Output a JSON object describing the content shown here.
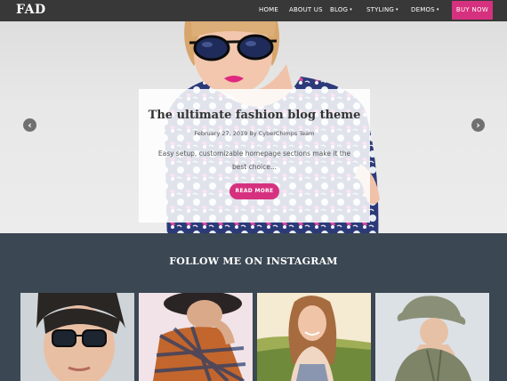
{
  "site": {
    "logo": "FAD"
  },
  "nav": {
    "items": [
      {
        "label": "HOME",
        "caret": ""
      },
      {
        "label": "ABOUT US",
        "caret": ""
      },
      {
        "label": "BLOG",
        "caret": "▾"
      },
      {
        "label": "STYLING",
        "caret": "▾"
      },
      {
        "label": "DEMOS",
        "caret": "▾"
      }
    ],
    "cta": "BUY NOW"
  },
  "hero": {
    "prev_arrow": "‹",
    "next_arrow": "›",
    "title": "The ultimate fashion blog theme",
    "meta": "February 27, 2019 By CyberChimps Team",
    "excerpt": "Easy setup, customizable homepage sections make it the best choice...",
    "button": "READ MORE"
  },
  "instagram": {
    "title": "FOLLOW ME ON INSTAGRAM",
    "photos": [
      "woman-sunglasses",
      "man-plaid-hat",
      "woman-field",
      "woman-bucket-hat"
    ]
  },
  "colors": {
    "accent": "#d6317f",
    "nav": "#383838",
    "insta_bg": "#3b4752"
  }
}
